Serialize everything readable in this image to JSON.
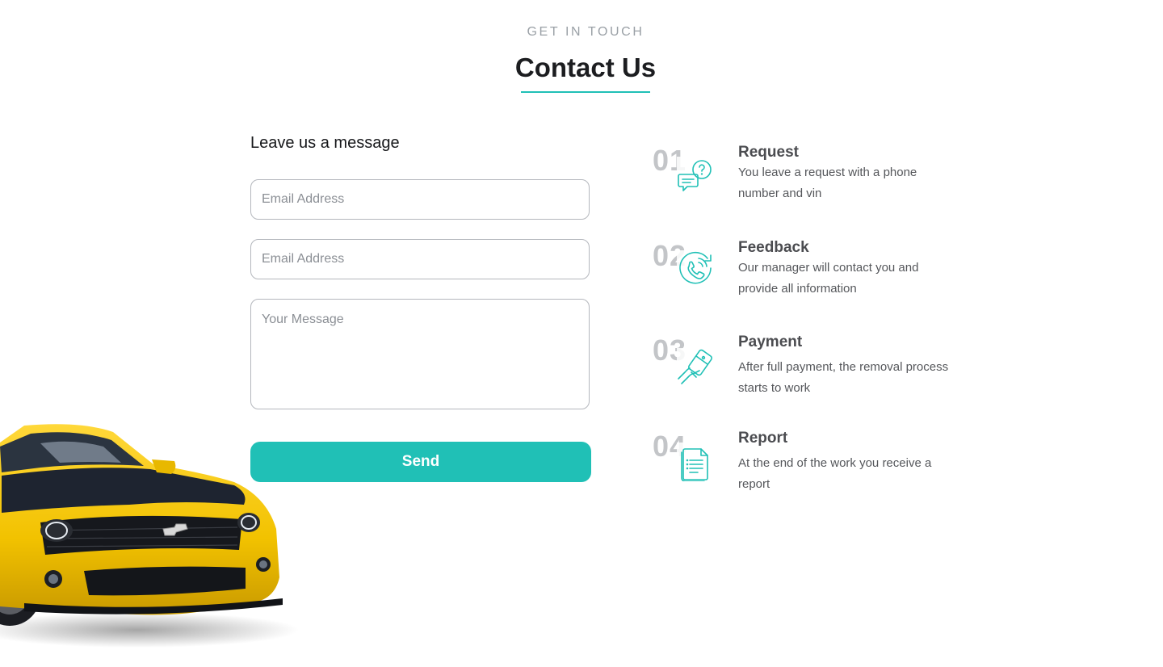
{
  "header": {
    "eyebrow": "GET IN TOUCH",
    "title": "Contact Us",
    "accent_color": "#20c0b6"
  },
  "form": {
    "heading": "Leave us a message",
    "fields": [
      {
        "placeholder": "Email Address",
        "value": ""
      },
      {
        "placeholder": "Email Address",
        "value": ""
      },
      {
        "placeholder": "Your Message",
        "value": ""
      }
    ],
    "submit_label": "Send"
  },
  "steps": [
    {
      "number": "01",
      "title": "Request",
      "text": "You leave a request with a phone number and vin",
      "icon": "chat-question-icon"
    },
    {
      "number": "02",
      "title": "Feedback",
      "text": "Our manager will contact you and provide all information",
      "icon": "phone-call-icon"
    },
    {
      "number": "03",
      "title": "Payment",
      "text": "After full payment, the removal process starts to work",
      "icon": "card-payment-icon"
    },
    {
      "number": "04",
      "title": "Report",
      "text": "At the end of the work you receive a report",
      "icon": "document-report-icon"
    }
  ],
  "colors": {
    "accent": "#20c0b6",
    "car_body": "#f2c200",
    "car_stripe": "#1e2430"
  }
}
